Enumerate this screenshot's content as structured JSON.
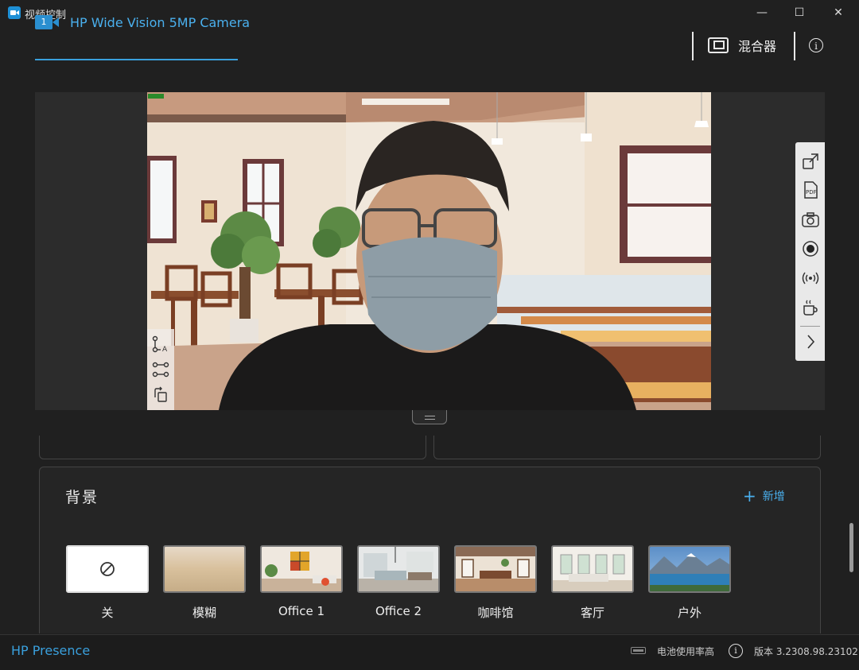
{
  "window": {
    "title": "视频控制",
    "min": "—",
    "max": "☐",
    "close": "✕"
  },
  "header": {
    "tab": {
      "badge": "1",
      "label": "HP Wide Vision 5MP Camera"
    },
    "mixer_label": "混合器",
    "info": "i"
  },
  "background": {
    "title": "背景",
    "add_label": "新增",
    "add_icon": "+",
    "items": [
      {
        "label": "关",
        "icon": "disabled-icon"
      },
      {
        "label": "模糊"
      },
      {
        "label": "Office 1"
      },
      {
        "label": "Office 2"
      },
      {
        "label": "咖啡馆"
      },
      {
        "label": "客厅"
      },
      {
        "label": "户外"
      }
    ]
  },
  "status": {
    "brand": "HP Presence",
    "battery_text": "电池使用率高",
    "info": "i",
    "version": "版本 3.2308.98.23102"
  },
  "colors": {
    "accent": "#3aa0dd",
    "background": "#202020"
  }
}
